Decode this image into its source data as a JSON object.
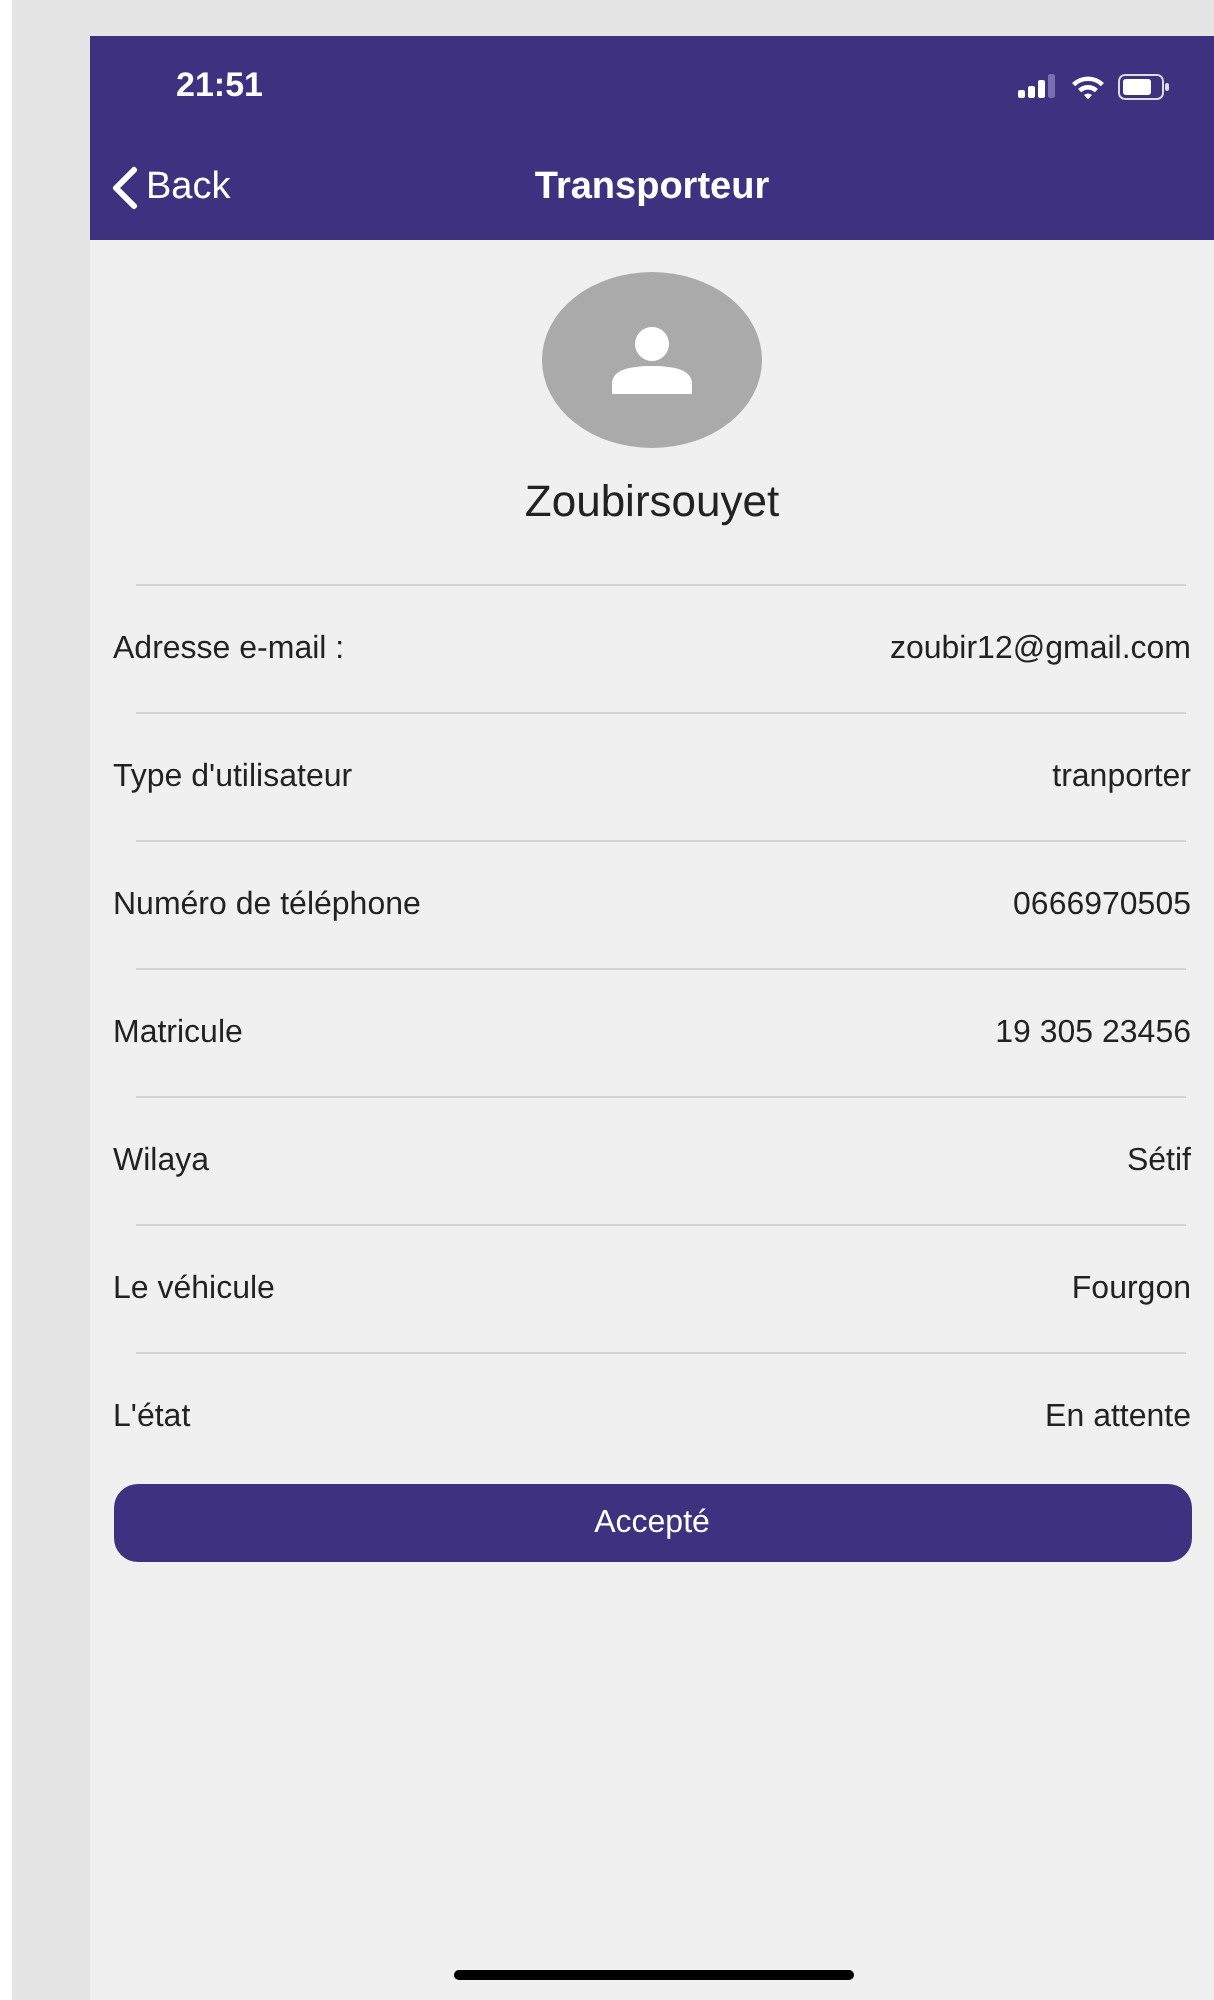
{
  "status_bar": {
    "time": "21:51"
  },
  "nav": {
    "back": "Back",
    "title": "Transporteur"
  },
  "profile": {
    "name": "Zoubirsouyet"
  },
  "fields": [
    {
      "label": "Adresse e-mail :",
      "value": "zoubir12@gmail.com"
    },
    {
      "label": "Type d'utilisateur",
      "value": "tranporter"
    },
    {
      "label": "Numéro de téléphone",
      "value": "0666970505"
    },
    {
      "label": "Matricule",
      "value": "19 305 23456"
    },
    {
      "label": "Wilaya",
      "value": "Sétif"
    },
    {
      "label": "Le véhicule",
      "value": "Fourgon"
    },
    {
      "label": "L'état",
      "value": "En attente"
    }
  ],
  "action_button": "Accepté"
}
